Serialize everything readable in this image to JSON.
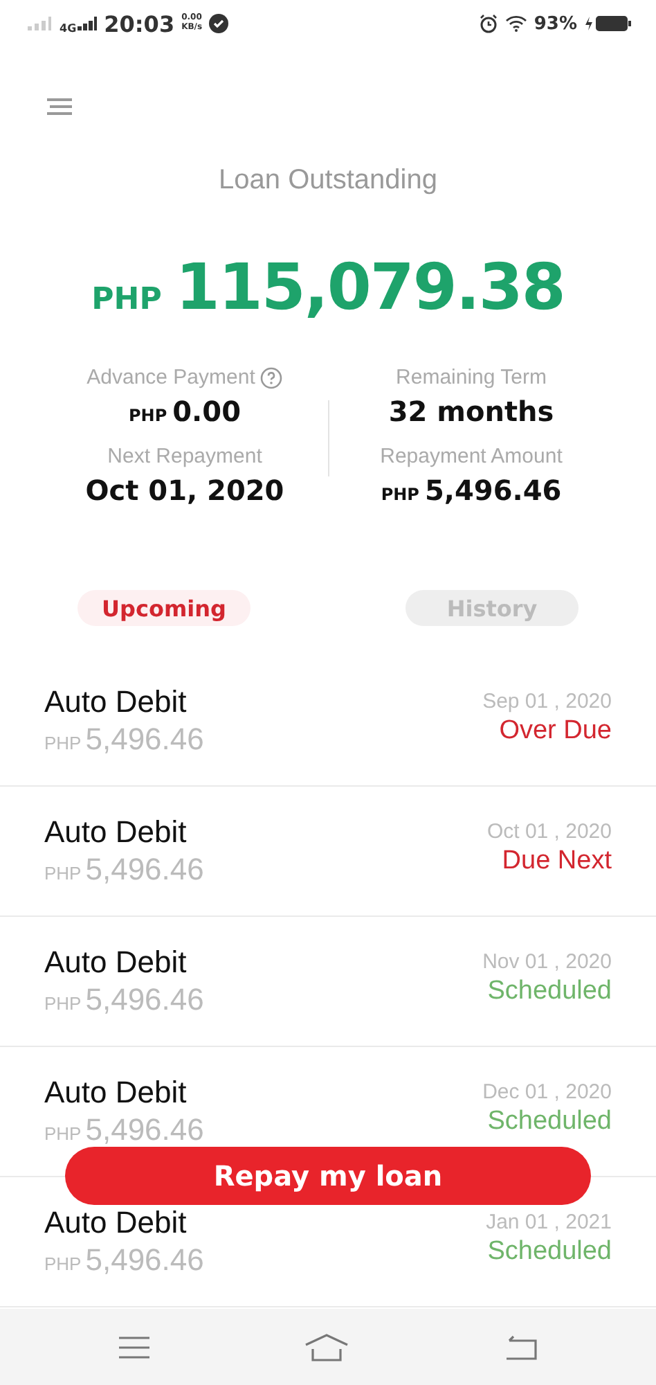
{
  "status_bar": {
    "network": "4G",
    "time": "20:03",
    "speed_value": "0.00",
    "speed_unit": "KB/s",
    "battery": "93%"
  },
  "title": "Loan Outstanding",
  "outstanding": {
    "currency": "PHP",
    "amount": "115,079.38"
  },
  "summary": [
    {
      "label": "Advance Payment",
      "currency": "PHP",
      "value": "0.00",
      "help": true
    },
    {
      "label": "Remaining Term",
      "value": "32 months",
      "help": false
    },
    {
      "label": "Next Repayment",
      "value": "Oct 01, 2020",
      "help": false
    },
    {
      "label": "Repayment Amount",
      "currency": "PHP",
      "value": "5,496.46",
      "help": false
    }
  ],
  "tabs": [
    {
      "label": "Upcoming",
      "selected": true
    },
    {
      "label": "History",
      "selected": false
    }
  ],
  "payments": [
    {
      "method": "Auto Debit",
      "currency": "PHP",
      "amount": "5,496.46",
      "date": "Sep 01 , 2020",
      "status": "Over Due",
      "kind": "overdue"
    },
    {
      "method": "Auto Debit",
      "currency": "PHP",
      "amount": "5,496.46",
      "date": "Oct 01 , 2020",
      "status": "Due Next",
      "kind": "due"
    },
    {
      "method": "Auto Debit",
      "currency": "PHP",
      "amount": "5,496.46",
      "date": "Nov 01 , 2020",
      "status": "Scheduled",
      "kind": "scheduled"
    },
    {
      "method": "Auto Debit",
      "currency": "PHP",
      "amount": "5,496.46",
      "date": "Dec 01 , 2020",
      "status": "Scheduled",
      "kind": "scheduled"
    },
    {
      "method": "Auto Debit",
      "currency": "PHP",
      "amount": "5,496.46",
      "date": "Jan 01 , 2021",
      "status": "Scheduled",
      "kind": "scheduled"
    }
  ],
  "action_button": "Repay my loan"
}
